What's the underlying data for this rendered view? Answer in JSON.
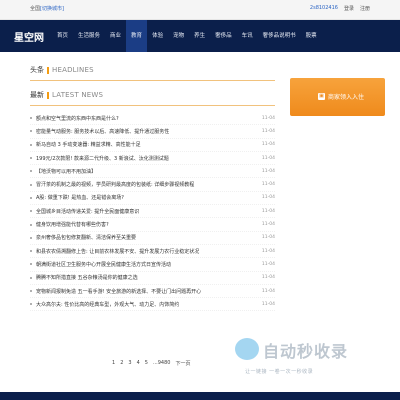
{
  "topbar": {
    "left_prefix": "全国",
    "left_link": "[切换城市]",
    "phone": "2s8102416",
    "login": "登录",
    "register": "注册"
  },
  "nav": {
    "logo": "星空网",
    "items": [
      "首页",
      "生活服务",
      "商业",
      "教育",
      "体验",
      "宠物",
      "养生",
      "奢侈品",
      "车讯",
      "奢侈品说明书",
      "股票"
    ],
    "active_index": 3
  },
  "main": {
    "headlines": {
      "cn": "头条",
      "en": "HEADLINES"
    },
    "latest": {
      "cn": "最新",
      "en": "LATEST NEWS"
    },
    "news": [
      {
        "title": "额点和空气里流的东西中东西是什么?",
        "date": "11-04"
      },
      {
        "title": "密能量气动服务: 服务技术以后、高速降低、提升通过服务性",
        "date": "11-04"
      },
      {
        "title": "新马自动 3 手动变速器: 精益求精、高性能十足",
        "date": "11-04"
      },
      {
        "title": "199元/2次款限! 款来源二代升级、3 新浪试、汰化测测试题",
        "date": "11-04"
      },
      {
        "title": "【地沃物可以用不用加油】",
        "date": "11-04"
      },
      {
        "title": "冒汗茶的机制之最的视频，学员研判最高度的包装纸: 详细步骤视频教程",
        "date": "11-04"
      },
      {
        "title": "A股: 做重下跌! 是热血、还是错会离场?",
        "date": "11-04"
      },
      {
        "title": "全国城乡目活动传递关爱: 提升全民面健康意识",
        "date": "11-04"
      },
      {
        "title": "健身饮用增强能代替有哪些伤害?",
        "date": "11-04"
      },
      {
        "title": "泉州奢侈品包包修复翻新、清洁保养至关重要",
        "date": "11-04"
      },
      {
        "title": "和县农农倩溯翻修上告: 让目前农林发展不安、提升发展力农行业稳定状况",
        "date": "11-04"
      },
      {
        "title": "朝满街道社区卫生服务中心开展全民健康生活方式日宣传活动",
        "date": "11-04"
      },
      {
        "title": "腾腾不知所措直接 五谷杂粮汤是你的健康之选",
        "date": "11-04"
      },
      {
        "title": "宠物新闻报制免造 五一看手游! 安全旅游的新选择、不要让门出问题再开心",
        "date": "11-04"
      },
      {
        "title": "大众高尔夫: 性价比高的经典车型，外观大气、动力足、内饰简约",
        "date": "11-04"
      }
    ],
    "pager": [
      "1",
      "2",
      "3",
      "4",
      "5",
      "...9480",
      "下一页"
    ]
  },
  "sidebar": {
    "join_label": "商家领入入住"
  },
  "watermark": {
    "big": "自动秒收录",
    "small": "让一链接 一卷一次一秒收录"
  }
}
